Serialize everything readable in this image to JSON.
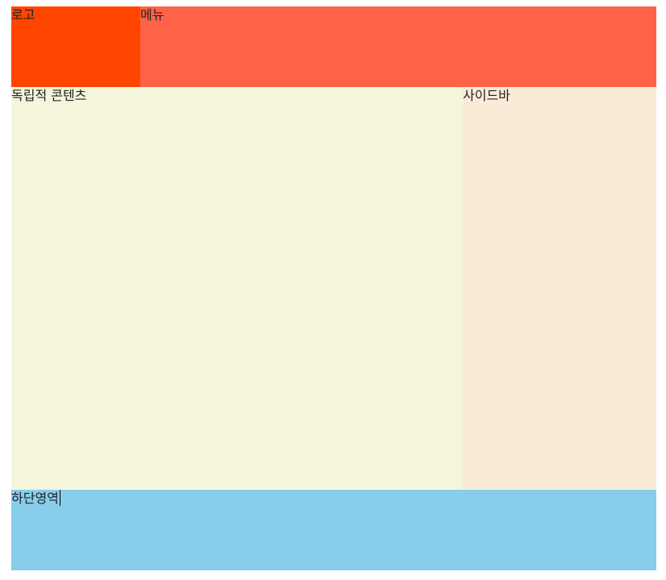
{
  "header": {
    "logo_label": "로고",
    "menu_label": "메뉴"
  },
  "main": {
    "content_label": "독립적 콘텐츠",
    "sidebar_label": "사이드바"
  },
  "footer": {
    "label": "하단영역"
  },
  "colors": {
    "logo": "#ff4500",
    "menu": "#ff6347",
    "content": "#f5f5dc",
    "sidebar": "#faebd7",
    "footer": "#87ceeb"
  }
}
